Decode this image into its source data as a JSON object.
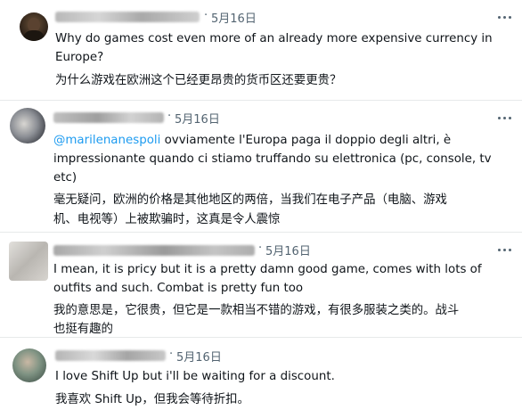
{
  "posts": [
    {
      "date": "5月16日",
      "lines": [
        "Why do games cost even more of an already more expensive currency in",
        "Europe?"
      ],
      "translation": [
        "为什么游戏在欧洲这个已经更昂贵的货币区还要更贵？"
      ],
      "avatar_color": "#3a2e22"
    },
    {
      "date": "5月16日",
      "mention": "@marilenanespoli",
      "lines": [
        " ovviamente l'Europa paga il doppio degli altri, è",
        "impressionante quando ci stiamo truffando su elettronica (pc, console, tv",
        "etc)"
      ],
      "translation": [
        "毫无疑问，欧洲的价格是其他地区的两倍，当我们在电子产品（电脑、游戏",
        "机、电视等）上被欺骗时，这真是令人震惊"
      ],
      "avatar_color": "#5b6270"
    },
    {
      "date": "5月16日",
      "lines": [
        "I mean, it is pricy but it is a pretty damn good game, comes with lots of",
        "outfits and such. Combat is pretty fun too"
      ],
      "translation": [
        "我的意思是，它很贵，但它是一款相当不错的游戏，有很多服装之类的。战斗",
        "也挺有趣的"
      ],
      "avatar_color": "#c9c7c4"
    },
    {
      "date": "5月16日",
      "lines": [
        "I love Shift Up but i'll be waiting for a discount."
      ],
      "translation": [
        "我喜欢 Shift Up，但我会等待折扣。"
      ],
      "avatar_color": "#7a8d7e"
    }
  ],
  "ui": {
    "separator": "·"
  }
}
